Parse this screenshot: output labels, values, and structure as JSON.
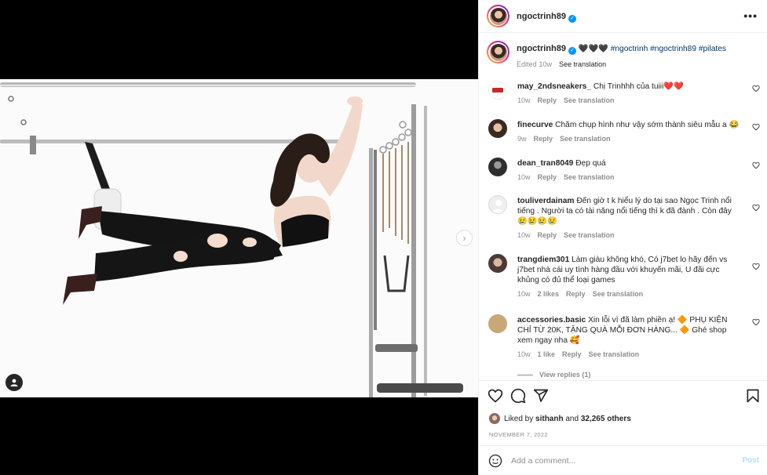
{
  "post": {
    "username": "ngoctrinh89",
    "verified_mark": "✓",
    "caption_emoji": "🖤🖤🖤",
    "hashtags": "#ngoctrinh #ngoctrinh89 #pilates",
    "edited": "Edited",
    "age": "10w",
    "see_translation": "See translation"
  },
  "comments": [
    {
      "username": "may_2ndsneakers_",
      "text": "Chị Trinhhh của tuiii",
      "emoji": "❤️❤️",
      "age": "10w",
      "likes": "",
      "reply": "Reply",
      "see_translation": "See translation",
      "avatar_color": "#ffffff"
    },
    {
      "username": "finecurve",
      "text": "Chăm chụp hình như vậy sớm thành siêu mẫu a",
      "emoji": "😂",
      "age": "9w",
      "likes": "",
      "reply": "Reply",
      "see_translation": "See translation",
      "avatar_color": "#5a4438"
    },
    {
      "username": "dean_tran8049",
      "text": "Đẹp quá",
      "emoji": "",
      "age": "10w",
      "likes": "",
      "reply": "Reply",
      "see_translation": "See translation",
      "avatar_color": "#3d3d3d"
    },
    {
      "username": "touliverdainam",
      "text": "Đến giờ t k hiểu lý do tại sao Ngọc Trinh nổi tiếng . Người ta có tài năng nổi tiếng thì k đã đành . Còn đây",
      "emoji": "😢😢😢😢",
      "age": "10w",
      "likes": "",
      "reply": "Reply",
      "see_translation": "See translation",
      "avatar_color": "#dbdbdb"
    },
    {
      "username": "trangdiem301",
      "text": "Làm giàu không khó, Có j7bet lo hãy đến vs j7bet nhà cái uy tính hàng đầu với khuyến mãi, U đãi cực khủng có đủ thể loại games",
      "emoji": "",
      "age": "10w",
      "likes": "2 likes",
      "reply": "Reply",
      "see_translation": "See translation",
      "avatar_color": "#7a6a6a"
    },
    {
      "username": "accessories.basic",
      "text": "Xin lỗi vì đã làm phiền ạ! 🔶 PHỤ KIỆN CHỈ TỪ 20K, TẶNG QUÀ MỖI ĐƠN HÀNG... 🔶 Ghé shop xem ngay nha",
      "emoji": "🥰",
      "age": "10w",
      "likes": "1 like",
      "reply": "Reply",
      "see_translation": "See translation",
      "avatar_color": "#c8a878"
    }
  ],
  "view_replies": "View replies (1)",
  "footer": {
    "liked_by_prefix": "Liked by",
    "liked_by_user": "sithanh",
    "liked_by_suffix": "and",
    "others": "32,265 others",
    "date": "NOVEMBER 7, 2022",
    "comment_placeholder": "Add a comment...",
    "post_label": "Post"
  },
  "media": {
    "next_arrow": "›"
  },
  "icons": [
    "more-icon",
    "heart-icon",
    "comment-icon",
    "share-icon",
    "save-icon",
    "emoji-icon",
    "tag-user-icon",
    "chevron-right-icon",
    "verified-icon"
  ],
  "colors": {
    "link": "#00376b",
    "verified": "#0095f6",
    "post_disabled": "#b2dffc",
    "meta": "#8e8e8e"
  }
}
